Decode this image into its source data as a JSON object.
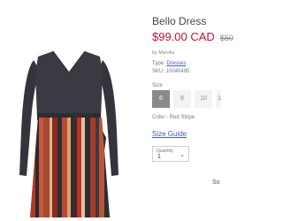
{
  "product": {
    "title": "Bello Dress",
    "price": "$99.00 CAD",
    "original_price": "$50",
    "brand_line": "by Marella",
    "type_label": "Type:",
    "type_value": "Dresses",
    "sku_line": "SKU: 10040495",
    "size_label": "Size",
    "sizes": [
      "6",
      "8",
      "10",
      "1"
    ],
    "selected_size": "6",
    "color_line": "Color - Red Stripe",
    "size_guide": "Size Guide",
    "quantity_label": "Quantity",
    "quantity_value": "1",
    "cut_text": "So"
  },
  "icons": {
    "quantity_chevron": "chevron-down-icon"
  },
  "colors": {
    "price": "#c8102e",
    "link": "#3a5fcd",
    "selected_size_bg": "#8a8a8a"
  }
}
